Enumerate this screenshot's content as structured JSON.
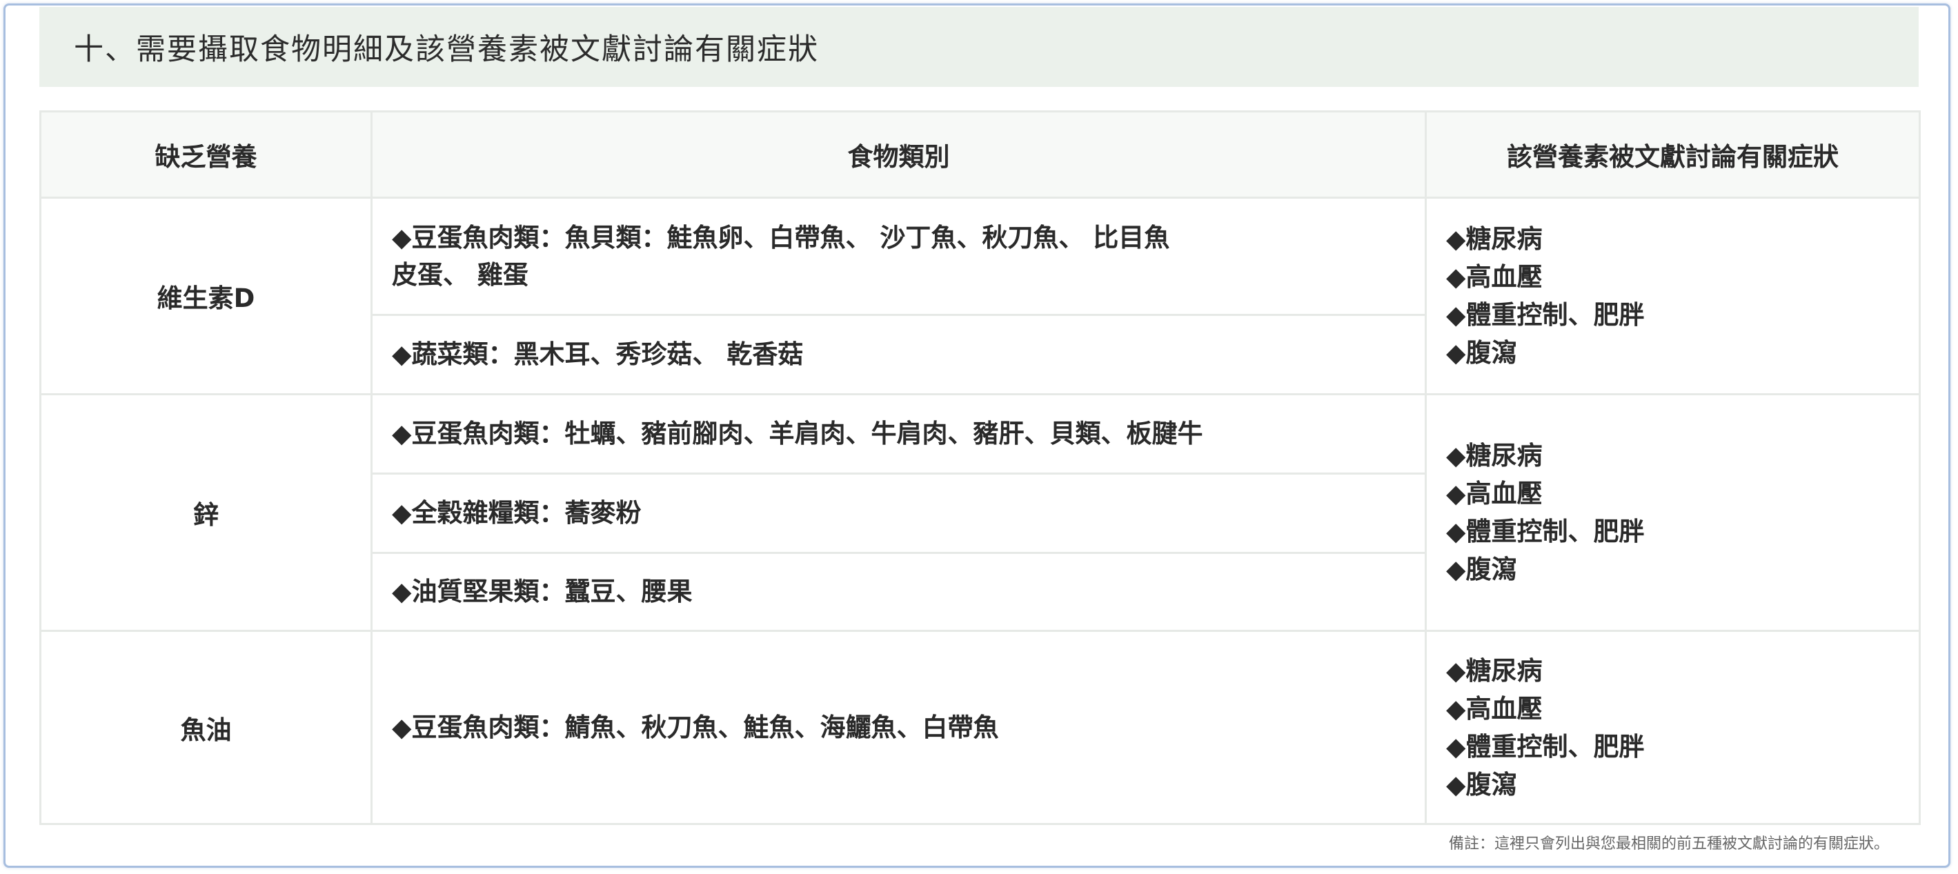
{
  "section": {
    "title": "十、需要攝取食物明細及該營養素被文獻討論有關症狀"
  },
  "table": {
    "headers": [
      "缺乏營養",
      "食物類別",
      "該營養素被文獻討論有關症狀"
    ],
    "groups": [
      {
        "nutrient": "維生素D",
        "foods": [
          [
            "◆豆蛋魚肉類：魚貝類：鮭魚卵、白帶魚、 沙丁魚、秋刀魚、 比目魚",
            "皮蛋、 雞蛋"
          ],
          [
            "◆蔬菜類：黑木耳、秀珍菇、 乾香菇"
          ]
        ],
        "symptoms": [
          "◆糖尿病",
          "◆高血壓",
          "◆體重控制、肥胖",
          "◆腹瀉"
        ]
      },
      {
        "nutrient": "鋅",
        "foods": [
          [
            "◆豆蛋魚肉類：牡蠣、豬前腳肉、羊肩肉、牛肩肉、豬肝、貝類、板腱牛"
          ],
          [
            "◆全穀雜糧類：蕎麥粉"
          ],
          [
            "◆油質堅果類：蠶豆、腰果"
          ]
        ],
        "symptoms": [
          "◆糖尿病",
          "◆高血壓",
          "◆體重控制、肥胖",
          "◆腹瀉"
        ]
      },
      {
        "nutrient": "魚油",
        "foods": [
          [
            "◆豆蛋魚肉類：鯖魚、秋刀魚、鮭魚、海鱺魚、白帶魚"
          ]
        ],
        "symptoms": [
          "◆糖尿病",
          "◆高血壓",
          "◆體重控制、肥胖",
          "◆腹瀉"
        ]
      }
    ]
  },
  "footnote": "備註：這裡只會列出與您最相關的前五種被文獻討論的有關症狀。",
  "colors": {
    "header_bg": "#ebf1eb",
    "frame_border": "#a7bedf",
    "cell_border": "#e6e9e6"
  }
}
